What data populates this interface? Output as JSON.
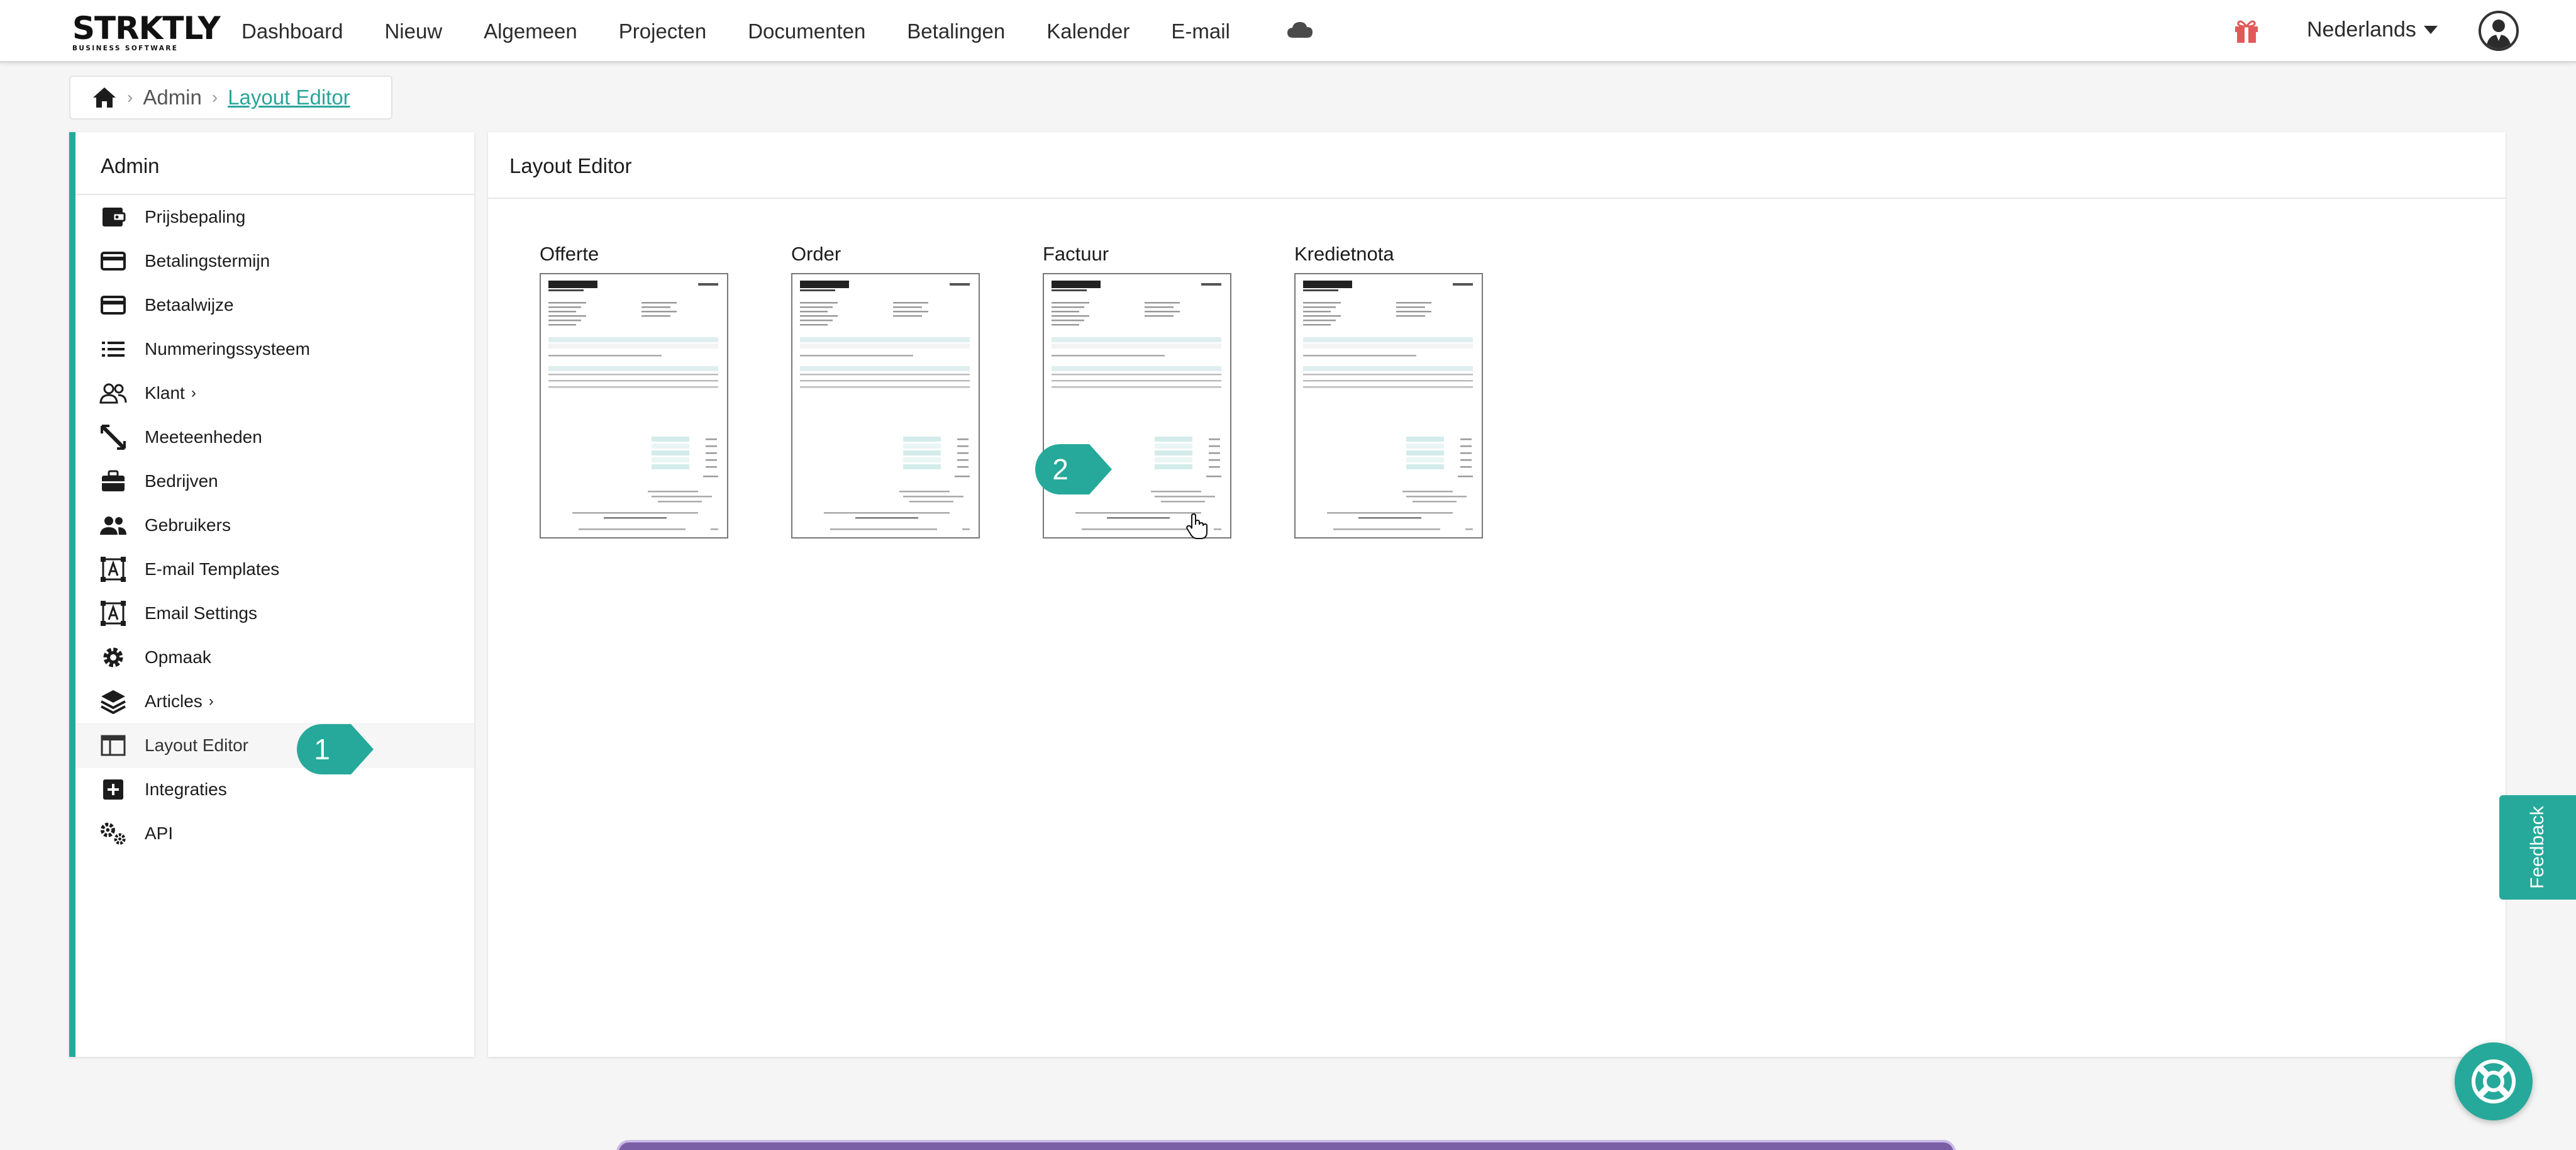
{
  "brand": {
    "name": "STRKTLY",
    "tagline": "BUSINESS SOFTWARE"
  },
  "nav": {
    "items": [
      {
        "label": "Dashboard"
      },
      {
        "label": "Nieuw"
      },
      {
        "label": "Algemeen"
      },
      {
        "label": "Projecten"
      },
      {
        "label": "Documenten"
      },
      {
        "label": "Betalingen"
      },
      {
        "label": "Kalender"
      },
      {
        "label": "E-mail"
      }
    ],
    "cloud_icon": "cloud-icon",
    "gift_icon": "gift-icon",
    "language": "Nederlands"
  },
  "breadcrumb": {
    "home_icon": "home-icon",
    "admin": "Admin",
    "current": "Layout Editor"
  },
  "sidebar": {
    "title": "Admin",
    "items": [
      {
        "label": "Prijsbepaling",
        "icon": "wallet-icon"
      },
      {
        "label": "Betalingstermijn",
        "icon": "credit-card-icon"
      },
      {
        "label": "Betaalwijze",
        "icon": "credit-card-icon"
      },
      {
        "label": "Nummeringssysteem",
        "icon": "list-icon"
      },
      {
        "label": "Klant",
        "icon": "users-icon",
        "has_submenu": true
      },
      {
        "label": "Meeteenheden",
        "icon": "ruler-icon"
      },
      {
        "label": "Bedrijven",
        "icon": "briefcase-icon"
      },
      {
        "label": "Gebruikers",
        "icon": "people-icon"
      },
      {
        "label": "E-mail Templates",
        "icon": "template-icon"
      },
      {
        "label": "Email Settings",
        "icon": "template-icon"
      },
      {
        "label": "Opmaak",
        "icon": "gear-icon"
      },
      {
        "label": "Articles",
        "icon": "layers-icon",
        "has_submenu": true
      },
      {
        "label": "Layout Editor",
        "icon": "layout-icon",
        "active": true
      },
      {
        "label": "Integraties",
        "icon": "plus-square-icon"
      },
      {
        "label": "API",
        "icon": "gears-icon"
      }
    ]
  },
  "main": {
    "title": "Layout Editor",
    "templates": [
      {
        "label": "Offerte"
      },
      {
        "label": "Order"
      },
      {
        "label": "Factuur"
      },
      {
        "label": "Kredietnota"
      }
    ]
  },
  "callouts": [
    {
      "number": "1"
    },
    {
      "number": "2"
    }
  ],
  "feedback_label": "Feedback",
  "colors": {
    "accent": "#26a99a",
    "link": "#2aa59a",
    "gift": "#e05a5a"
  }
}
